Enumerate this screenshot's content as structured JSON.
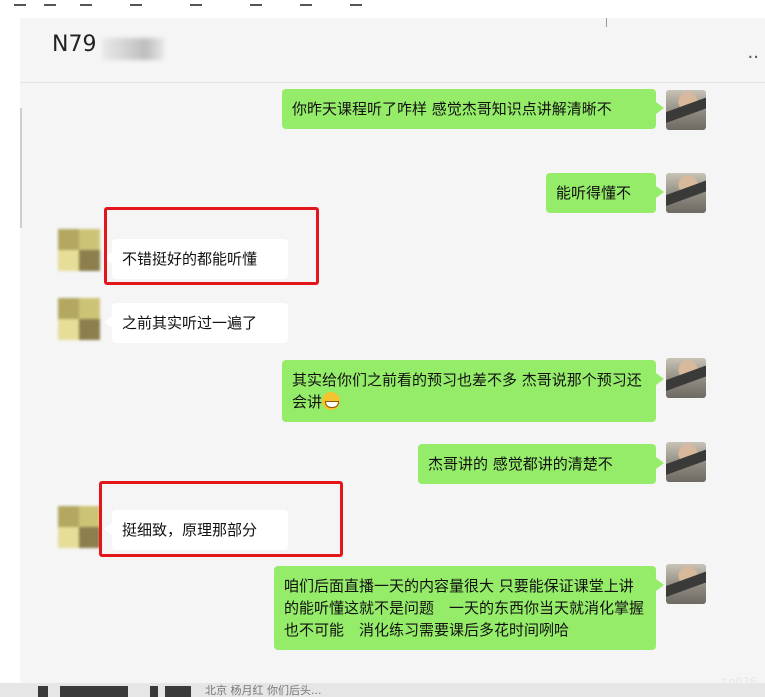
{
  "chat": {
    "title": "N79",
    "more_label": "..",
    "messages": [
      {
        "from": "me",
        "text": "你昨天课程听了咋样 感觉杰哥知识点讲解清晰不"
      },
      {
        "from": "me",
        "text": "能听得懂不"
      },
      {
        "from": "them",
        "text": "不错挺好的都能听懂",
        "highlighted": true
      },
      {
        "from": "them",
        "text": "之前其实听过一遍了"
      },
      {
        "from": "me",
        "text": "其实给你们之前看的预习也差不多 杰哥说那个预习还会讲",
        "emoji": "grinning-face"
      },
      {
        "from": "me",
        "text": "杰哥讲的 感觉都讲的清楚不"
      },
      {
        "from": "them",
        "text": "挺细致，原理那部分",
        "highlighted": true
      },
      {
        "from": "me",
        "text": "咱们后面直播一天的内容量很大 只要能保证课堂上讲的能听懂这就不是问题　一天的东西你当天就消化掌握也不可能　消化练习需要课后多花时间咧哈"
      }
    ]
  },
  "colors": {
    "outgoing_bubble": "#95ec69",
    "incoming_bubble": "#ffffff",
    "highlight_box": "#e3161b",
    "background": "#f5f5f5"
  },
  "taskbar": {
    "text": "北京 杨月红 你们后头..."
  },
  "watermark": "tg036"
}
